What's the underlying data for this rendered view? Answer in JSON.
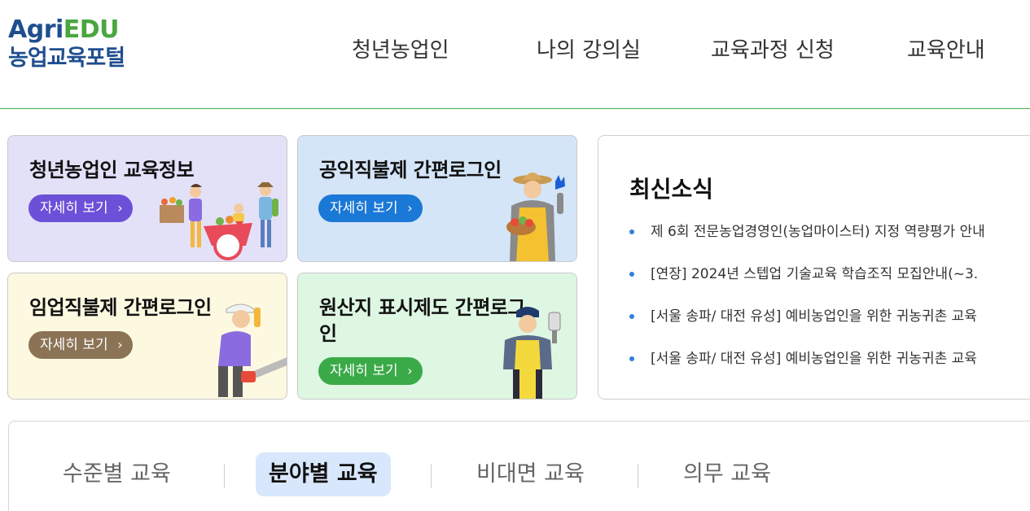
{
  "logo": {
    "part1": "Agri",
    "part2": "EDU",
    "subtitle": "농업교육포털"
  },
  "nav": [
    {
      "label": "청년농업인"
    },
    {
      "label": "나의 강의실"
    },
    {
      "label": "교육과정 신청"
    },
    {
      "label": "교육안내"
    }
  ],
  "cards": [
    {
      "title": "청년농업인 교육정보",
      "button": "자세히 보기",
      "bg": "#e3e1f8",
      "button_color": "#6c50d8"
    },
    {
      "title": "공익직불제 간편로그인",
      "button": "자세히 보기",
      "bg": "#d4e5f8",
      "button_color": "#1a78d6"
    },
    {
      "title": "임업직불제 간편로그인",
      "button": "자세히 보기",
      "bg": "#fdf9e1",
      "button_color": "#8b7355"
    },
    {
      "title_line1": "원산지 표시제도 간편로그",
      "title_line2": "인",
      "button": "자세히 보기",
      "bg": "#def7e2",
      "button_color": "#3aaa48"
    }
  ],
  "news": {
    "title": "최신소식",
    "items": [
      "제 6회 전문농업경영인(농업마이스터) 지정 역량평가 안내",
      "[연장] 2024년 스텝업 기술교육 학습조직 모집안내(~3.",
      "[서울 송파/ 대전 유성] 예비농업인을 위한 귀농귀촌 교육",
      "[서울 송파/ 대전 유성] 예비농업인을 위한 귀농귀촌 교육"
    ]
  },
  "tabs": [
    {
      "label": "수준별 교육"
    },
    {
      "label": "분야별 교육"
    },
    {
      "label": "비대면 교육"
    },
    {
      "label": "의무 교육"
    }
  ],
  "colors": {
    "accent_green": "#4caf50",
    "brand_blue": "#1f4e8f",
    "news_bullet": "#2f80d8",
    "active_tab_bg": "#d8e7fb"
  }
}
